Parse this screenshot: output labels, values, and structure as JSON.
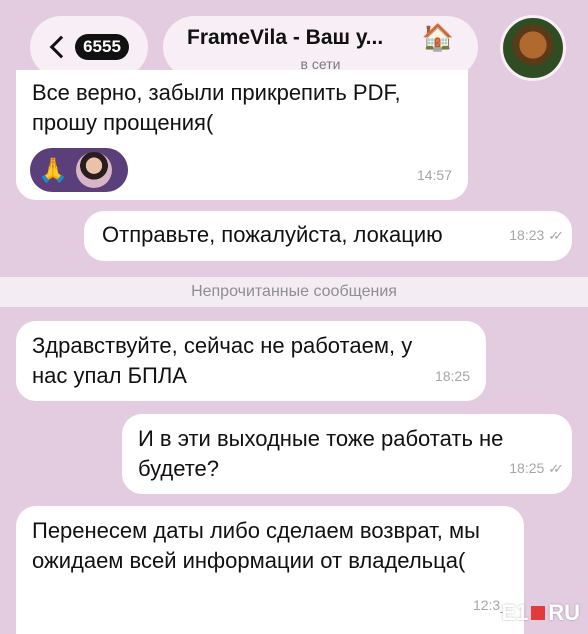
{
  "header": {
    "back_count": "6555",
    "title": "FrameVila - Ваш у...",
    "status": "в сети",
    "title_icon": "house-icon",
    "avatar_icon": "dog-avatar"
  },
  "messages": [
    {
      "text": "Все верно, забыли прикрепить PDF, прошу прощения(",
      "time": "14:57",
      "reactions": [
        "🙏"
      ]
    },
    {
      "text": "Отправьте, пожалуйста, локацию",
      "time": "18:23",
      "read": "✓✓"
    },
    {
      "text": "Здравствуйте, сейчас не работаем, у нас упал БПЛА",
      "time": "18:25"
    },
    {
      "text": "И в эти выходные тоже работать не будете?",
      "time": "18:25",
      "read": "✓✓"
    },
    {
      "text": "Перенесем даты либо сделаем возврат, мы ожидаем всей информации от владельца(",
      "time": "12:3_"
    }
  ],
  "unread_divider": "Непрочитанные сообщения",
  "watermark": {
    "left": "E1",
    "right": "RU"
  }
}
